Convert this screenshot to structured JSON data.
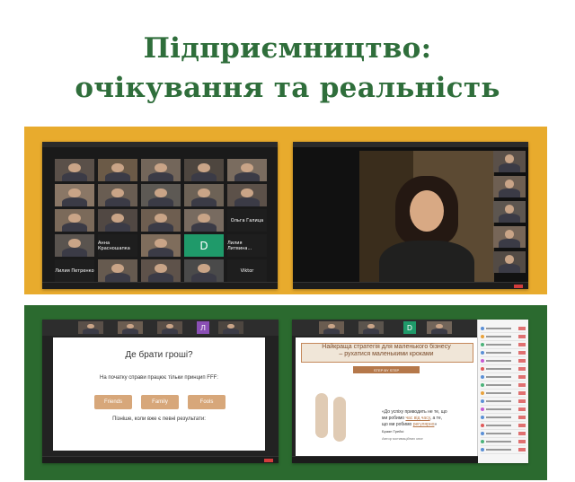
{
  "heading": {
    "line1": "Підприємництво:",
    "line2": "очікування та реальність"
  },
  "colors": {
    "heading": "#2f6e3b",
    "band_top": "#e8ab2d",
    "band_bottom": "#2b6a2f",
    "chip": "#d7a77a"
  },
  "screen1": {
    "name_labels": [
      "Ольга Галица",
      "Анна Красношапка",
      "Лилия Литвина...",
      "Лилия Петренко",
      "Viktor"
    ],
    "avatar_letter": "D"
  },
  "screen2": {
    "description_icon": "video-call-speaker"
  },
  "screen3": {
    "slide_title": "Де брати гроші?",
    "slide_subtitle": "На початку справи працює тільки принцип FFF:",
    "chips": [
      "Friends",
      "Family",
      "Fools"
    ],
    "slide_footer": "Пізніше, коли вже є певні результати:",
    "avatar_letter": "Л"
  },
  "screen4": {
    "headline_1": "Найкраща стратегія для маленького бізнесу",
    "headline_2": "– рухатися маленькими кроками",
    "step_label": "STEP BY STEP",
    "quote_1": "«До успіху приводить не те, що",
    "quote_2": "ми робимо",
    "quote_2u": "час від часу",
    "quote_2b": ", а те,",
    "quote_3": "що ми робимо",
    "quote_3u": "регулярно",
    "quote_3b": "»",
    "author": "Браян Трейсі",
    "author_role": "Автор мотиваційних книг",
    "avatar_letter": "D"
  }
}
